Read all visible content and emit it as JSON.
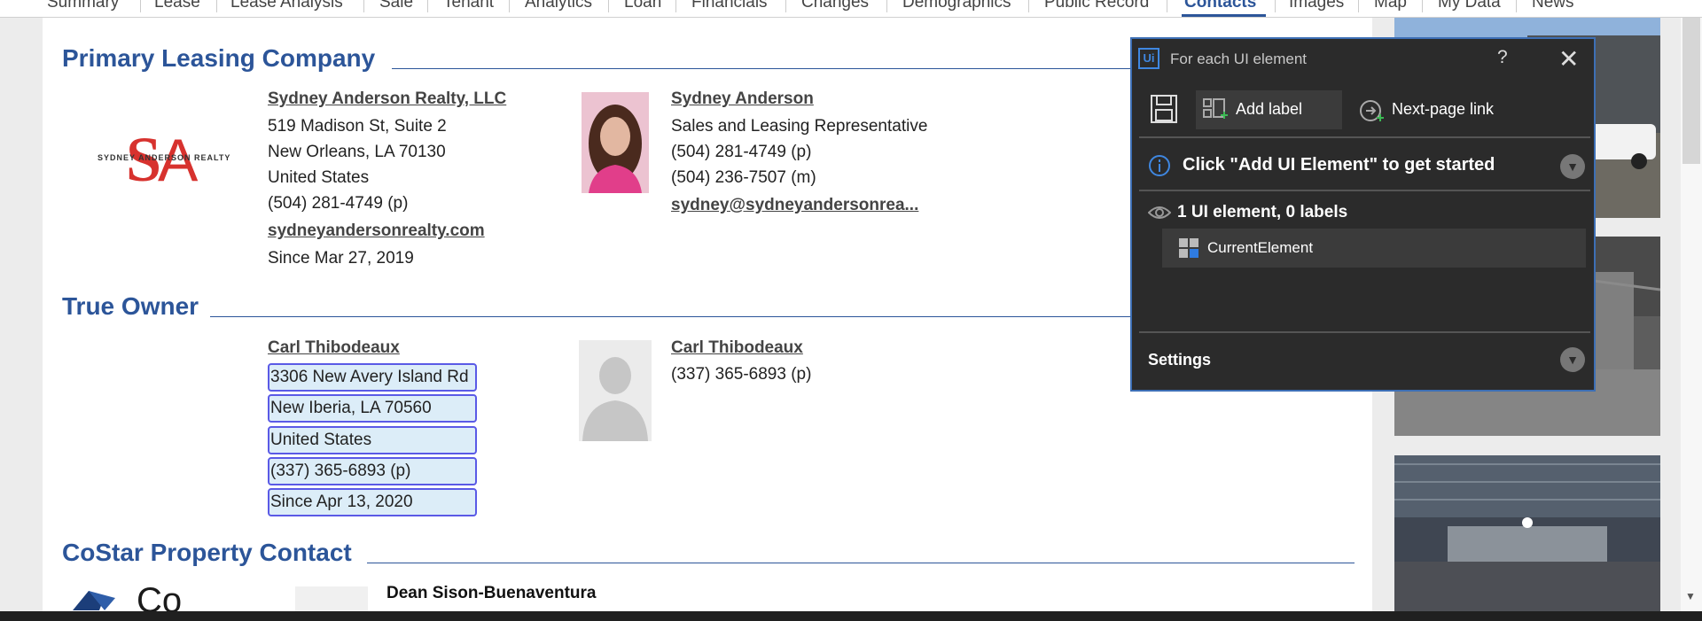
{
  "tabs": [
    "Summary",
    "Lease",
    "Lease Analysis",
    "Sale",
    "Tenant",
    "Analytics",
    "Loan",
    "Financials",
    "Changes",
    "Demographics",
    "Public Record",
    "Contacts",
    "Images",
    "Map",
    "My Data",
    "News"
  ],
  "active_tab": "Contacts",
  "primary": {
    "title": "Primary Leasing Company",
    "logo_text": "SYDNEY ANDERSON REALTY",
    "company_name": "Sydney Anderson Realty, LLC",
    "address1": "519 Madison St, Suite 2",
    "address2": "New Orleans, LA 70130",
    "country": "United States",
    "phone": "(504) 281-4749 (p)",
    "website": "sydneyandersonrealty.com",
    "since": "Since Mar 27, 2019",
    "contact_name": "Sydney Anderson",
    "contact_role": "Sales and Leasing Representative",
    "contact_phone": "(504) 281-4749 (p)",
    "contact_mobile": "(504) 236-7507 (m)",
    "contact_email": "sydney@sydneyandersonrea..."
  },
  "owner": {
    "title": "True Owner",
    "name": "Carl Thibodeaux",
    "address1": "3306 New Avery Island Rd",
    "address2": "New Iberia, LA 70560",
    "country": "United States",
    "phone": "(337) 365-6893 (p)",
    "since": "Since Apr 13, 2020",
    "contact_name": "Carl Thibodeaux",
    "contact_phone": "(337) 365-6893 (p)"
  },
  "costar": {
    "title": "CoStar Property Contact",
    "contact_name": "Dean Sison-Buenaventura"
  },
  "dialog": {
    "title": "For each UI element",
    "logo": "Ui",
    "help": "?",
    "close": "✕",
    "add_label": "Add label",
    "next_page_link": "Next-page link",
    "hint": "Click \"Add UI Element\" to get started",
    "summary": "1 UI element, 0 labels",
    "element_name": "CurrentElement",
    "settings": "Settings"
  },
  "colors": {
    "accent": "#2c5599",
    "dialog_bg": "#2b2b2b",
    "highlight_border": "#5a5ae6",
    "highlight_fill": "#dcedf8"
  }
}
